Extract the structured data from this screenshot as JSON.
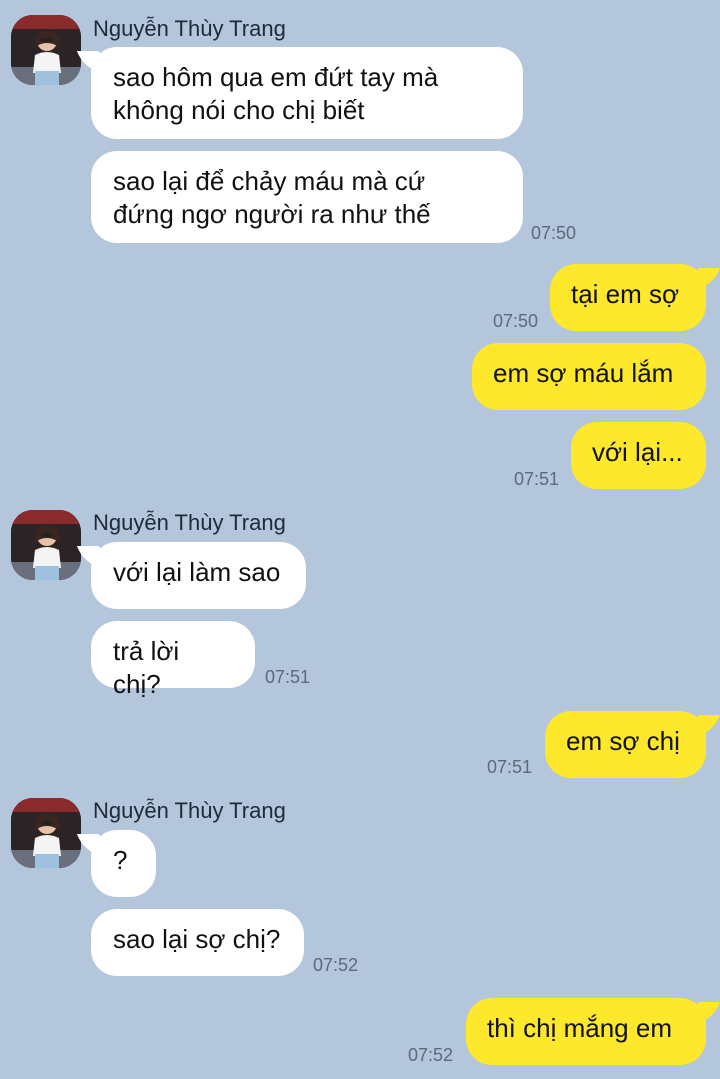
{
  "contact": {
    "name": "Nguyễn Thùy Trang"
  },
  "messages": [
    {
      "text": "sao hôm qua em đứt tay mà\nkhông nói cho chị biết"
    },
    {
      "text": "sao lại để chảy máu mà cứ\nđứng ngơ người ra như thế",
      "time": "07:50"
    },
    {
      "text": "tại em sợ",
      "time": "07:50"
    },
    {
      "text": "em sợ máu lắm"
    },
    {
      "text": "với lại...",
      "time": "07:51"
    },
    {
      "text": "với lại làm sao"
    },
    {
      "text": "trả lời chị?",
      "time": "07:51"
    },
    {
      "text": "em sợ chị",
      "time": "07:51"
    },
    {
      "text": "?"
    },
    {
      "text": "sao lại sợ chị?",
      "time": "07:52"
    },
    {
      "text": "thì chị mắng em",
      "time": "07:52"
    }
  ],
  "icons": {
    "avatar": "profile-photo-avatar"
  },
  "colors": {
    "background": "#b3c6dc",
    "incoming": "#ffffff",
    "outgoing": "#fde82c"
  }
}
